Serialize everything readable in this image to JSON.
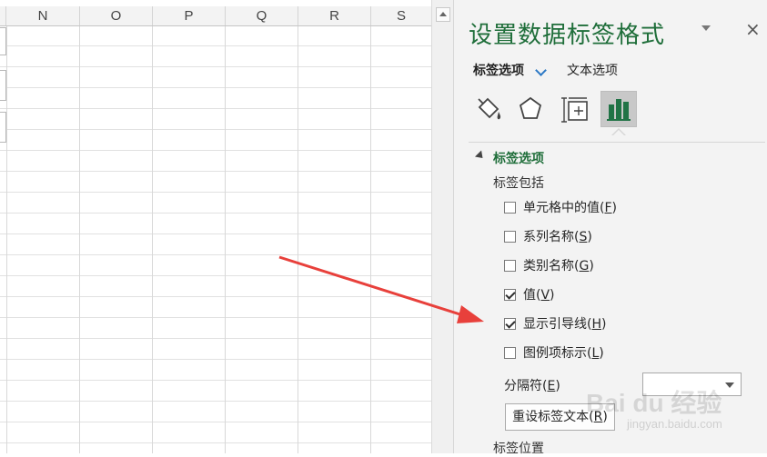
{
  "sheet": {
    "columns": [
      "N",
      "O",
      "P",
      "Q",
      "R",
      "S"
    ]
  },
  "pane": {
    "title": "设置数据标签格式",
    "close_glyph": "×",
    "tabs": {
      "label_options": "标签选项",
      "text_options": "文本选项"
    },
    "icons": [
      "paint-bucket-icon",
      "pentagon-effects-icon",
      "size-properties-icon",
      "bar-chart-label-icon"
    ],
    "section": {
      "title": "标签选项",
      "includes_title": "标签包括",
      "checkboxes": [
        {
          "text": "单元格中的值(",
          "key": "F",
          "tail": ")",
          "checked": false
        },
        {
          "text": "系列名称(",
          "key": "S",
          "tail": ")",
          "checked": false
        },
        {
          "text": "类别名称(",
          "key": "G",
          "tail": ")",
          "checked": false
        },
        {
          "text": "值(",
          "key": "V",
          "tail": ")",
          "checked": true
        },
        {
          "text": "显示引导线(",
          "key": "H",
          "tail": ")",
          "checked": true
        },
        {
          "text": "图例项标示(",
          "key": "L",
          "tail": ")",
          "checked": false
        }
      ],
      "separator": {
        "label": "分隔符(",
        "key": "E",
        "tail": ")",
        "value": ""
      },
      "reset_button": {
        "text": "重设标签文本(",
        "key": "R",
        "tail": ")"
      },
      "position_title": "标签位置"
    },
    "accent_color": "#1f6e3a"
  },
  "annotation": {
    "arrow_color": "#e8403b"
  },
  "watermark": {
    "brand": "Bai du 经验",
    "url": "jingyan.baidu.com"
  }
}
